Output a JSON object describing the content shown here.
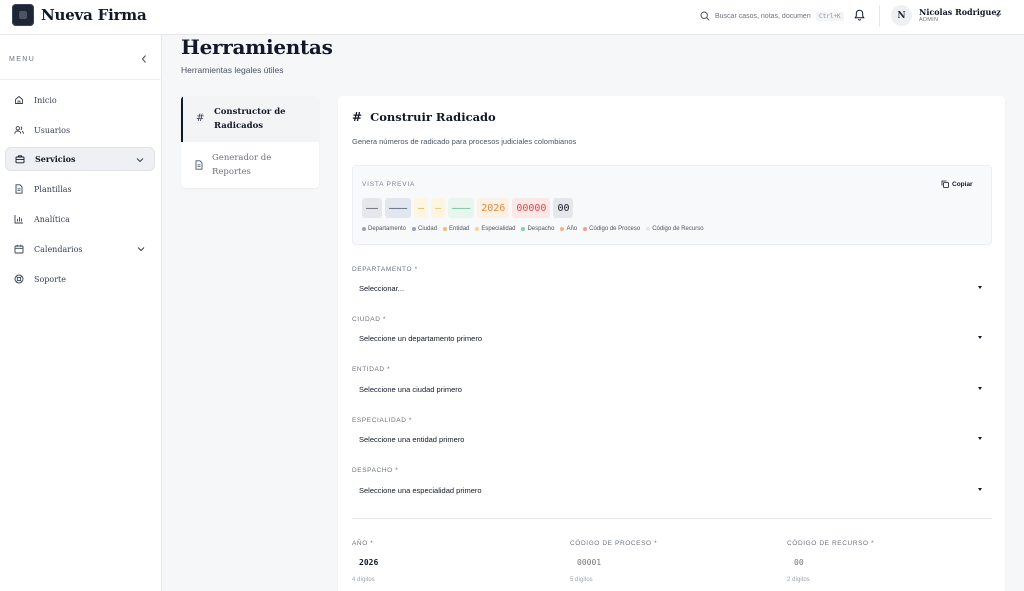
{
  "app": {
    "title": "Nueva Firma"
  },
  "topbar": {
    "search_placeholder": "Buscar casos, notas, documentos...",
    "search_shortcut": "Ctrl+K",
    "user_name": "Nicolas Rodriguez",
    "user_role": "ADMIN",
    "user_initial": "N"
  },
  "sidebar": {
    "menu_label": "MENU",
    "items": [
      {
        "label": "Inicio",
        "icon": "home-icon"
      },
      {
        "label": "Usuarios",
        "icon": "users-icon"
      },
      {
        "label": "Servicios",
        "icon": "briefcase-icon",
        "active": true
      },
      {
        "label": "Plantillas",
        "icon": "file-icon"
      },
      {
        "label": "Analítica",
        "icon": "bar-chart-icon"
      },
      {
        "label": "Calendarios",
        "icon": "calendar-icon"
      },
      {
        "label": "Soporte",
        "icon": "support-icon"
      }
    ]
  },
  "page": {
    "title": "Herramientas",
    "subtitle": "Herramientas legales útiles"
  },
  "tools": [
    {
      "label": "Constructor de Radicados",
      "icon": "hash-icon",
      "active": true
    },
    {
      "label": "Generador de Reportes",
      "icon": "file-text-icon",
      "active": false
    }
  ],
  "builder": {
    "title": "Construir Radicado",
    "description": "Genera números de radicado para procesos judiciales colombianos",
    "preview_label": "VISTA PREVIA",
    "copy_label": "Copiar",
    "segments": [
      {
        "text": "——",
        "bg": "#e5e7eb",
        "fg": "#374151"
      },
      {
        "text": "———",
        "bg": "#e2e6ef",
        "fg": "#334155"
      },
      {
        "text": "—",
        "bg": "#fdf6e3",
        "fg": "#d9a13b"
      },
      {
        "text": "—",
        "bg": "#fdf5e1",
        "fg": "#e0b24a"
      },
      {
        "text": "———",
        "bg": "#e8f6ef",
        "fg": "#4fae86"
      },
      {
        "text": "2026",
        "bg": "#fdf1e6",
        "fg": "#e08a3c"
      },
      {
        "text": "00000",
        "bg": "#fde8e8",
        "fg": "#d94a4a"
      },
      {
        "text": "00",
        "bg": "#e5e7eb",
        "fg": "#111827"
      }
    ],
    "legend": [
      {
        "label": "Departamento",
        "color": "#9ca3af"
      },
      {
        "label": "Ciudad",
        "color": "#94a3b8"
      },
      {
        "label": "Entidad",
        "color": "#e9c46a"
      },
      {
        "label": "Especialidad",
        "color": "#f2d98a"
      },
      {
        "label": "Despacho",
        "color": "#86d0ad"
      },
      {
        "label": "Año",
        "color": "#f4b183"
      },
      {
        "label": "Código de Proceso",
        "color": "#f19a9a"
      },
      {
        "label": "Código de Recurso",
        "color": "#e5e7eb"
      }
    ],
    "fields": [
      {
        "label": "DEPARTAMENTO *",
        "value": "Seleccionar..."
      },
      {
        "label": "CIUDAD *",
        "value": "Seleccione un departamento primero"
      },
      {
        "label": "ENTIDAD *",
        "value": "Seleccione una ciudad primero"
      },
      {
        "label": "ESPECIALIDAD *",
        "value": "Seleccione una entidad primero"
      },
      {
        "label": "DESPACHO *",
        "value": "Seleccione una especialidad primero"
      }
    ],
    "year": {
      "label": "AÑO *",
      "value": "2026",
      "hint": "4 dígitos"
    },
    "process_code": {
      "label": "CÓDIGO DE PROCESO *",
      "placeholder": "00001",
      "hint": "5 dígitos"
    },
    "appeal_code": {
      "label": "CÓDIGO DE RECURSO *",
      "placeholder": "00",
      "hint": "2 dígitos"
    }
  }
}
